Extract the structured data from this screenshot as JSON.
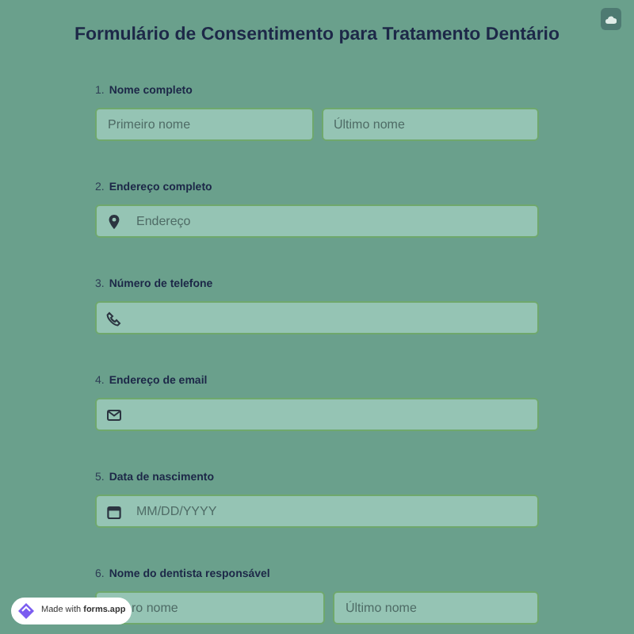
{
  "title": "Formulário de Consentimento para Tratamento Dentário",
  "questions": [
    {
      "number": "1.",
      "label": "Nome completo",
      "kind": "name",
      "fields": [
        {
          "placeholder": "Primeiro nome"
        },
        {
          "placeholder": "Último nome"
        }
      ]
    },
    {
      "number": "2.",
      "label": "Endereço completo",
      "kind": "address",
      "placeholder": "Endereço"
    },
    {
      "number": "3.",
      "label": "Número de telefone",
      "kind": "phone"
    },
    {
      "number": "4.",
      "label": "Endereço de email",
      "kind": "email"
    },
    {
      "number": "5.",
      "label": "Data de nascimento",
      "kind": "date",
      "placeholder": "MM/DD/YYYY"
    },
    {
      "number": "6.",
      "label": "Nome do dentista responsável",
      "kind": "name",
      "fields": [
        {
          "placeholder": "ro nome",
          "covered": true
        },
        {
          "placeholder": "Último nome"
        }
      ]
    }
  ],
  "badge": {
    "prefix": "Made with",
    "brand": "forms.app"
  }
}
